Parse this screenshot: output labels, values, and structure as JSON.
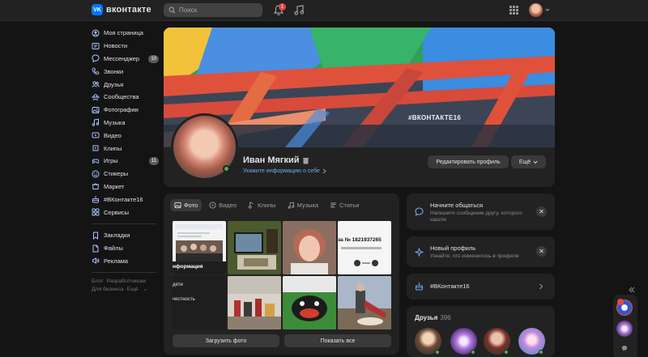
{
  "topbar": {
    "logo_mark": "VK",
    "logo_text": "вконтакте",
    "search_placeholder": "Поиск",
    "notifications_badge": "1"
  },
  "sidebar": {
    "items": [
      {
        "label": "Моя страница",
        "icon": "user-circle-icon",
        "badge": ""
      },
      {
        "label": "Новости",
        "icon": "newspaper-icon",
        "badge": ""
      },
      {
        "label": "Мессенджер",
        "icon": "message-icon",
        "badge": "10"
      },
      {
        "label": "Звонки",
        "icon": "phone-icon",
        "badge": ""
      },
      {
        "label": "Друзья",
        "icon": "friends-icon",
        "badge": ""
      },
      {
        "label": "Сообщества",
        "icon": "communities-icon",
        "badge": ""
      },
      {
        "label": "Фотографии",
        "icon": "photo-icon",
        "badge": ""
      },
      {
        "label": "Музыка",
        "icon": "music-icon",
        "badge": ""
      },
      {
        "label": "Видео",
        "icon": "video-icon",
        "badge": ""
      },
      {
        "label": "Клипы",
        "icon": "clips-icon",
        "badge": ""
      },
      {
        "label": "Игры",
        "icon": "games-icon",
        "badge": "11"
      },
      {
        "label": "Стикеры",
        "icon": "sticker-icon",
        "badge": ""
      },
      {
        "label": "Маркет",
        "icon": "market-icon",
        "badge": ""
      },
      {
        "label": "#ВКонтакте16",
        "icon": "birthday-icon",
        "badge": ""
      },
      {
        "label": "Сервисы",
        "icon": "services-icon",
        "badge": ""
      }
    ],
    "items2": [
      {
        "label": "Закладки",
        "icon": "bookmark-icon"
      },
      {
        "label": "Файлы",
        "icon": "files-icon"
      },
      {
        "label": "Реклама",
        "icon": "ads-icon"
      }
    ],
    "footer": [
      "Блог",
      "Разработчикам",
      "Для бизнеса",
      "Ещё"
    ]
  },
  "profile": {
    "cover_tag": "#ВКОНТАКТЕ16",
    "name": "Иван Мягкий",
    "info_link": "Укажите информацию о себе",
    "edit_button": "Редактировать профиль",
    "more_button": "Ещё"
  },
  "media": {
    "tabs": [
      {
        "label": "Фото",
        "icon": "photo-tab-icon",
        "active": true
      },
      {
        "label": "Видео",
        "icon": "video-tab-icon",
        "active": false
      },
      {
        "label": "Клипы",
        "icon": "clips-tab-icon",
        "active": false
      },
      {
        "label": "Музыка",
        "icon": "music-tab-icon",
        "active": false
      },
      {
        "label": "Статьи",
        "icon": "articles-tab-icon",
        "active": false
      }
    ],
    "photo_text": {
      "p1_heading": "нформация",
      "p1_line1": "дети",
      "p1_line2": "честность",
      "p4_title": "за № 1821937265"
    },
    "upload_button": "Загрузить фото",
    "show_all_button": "Показать все"
  },
  "cards": {
    "start_chat": {
      "title": "Начните общаться",
      "subtitle": "Напишите сообщение другу, которого нашли"
    },
    "new_profile": {
      "title": "Новый профиль",
      "subtitle": "Узнайте, что изменилось в профиле"
    },
    "vk16": {
      "title": "#ВКонтакте16"
    },
    "friends": {
      "title": "Друзья",
      "count": "396"
    }
  },
  "colors": {
    "accent": "#0077ff",
    "link": "#71aaeb",
    "online": "#4bb34b",
    "badge_red": "#e64646"
  }
}
